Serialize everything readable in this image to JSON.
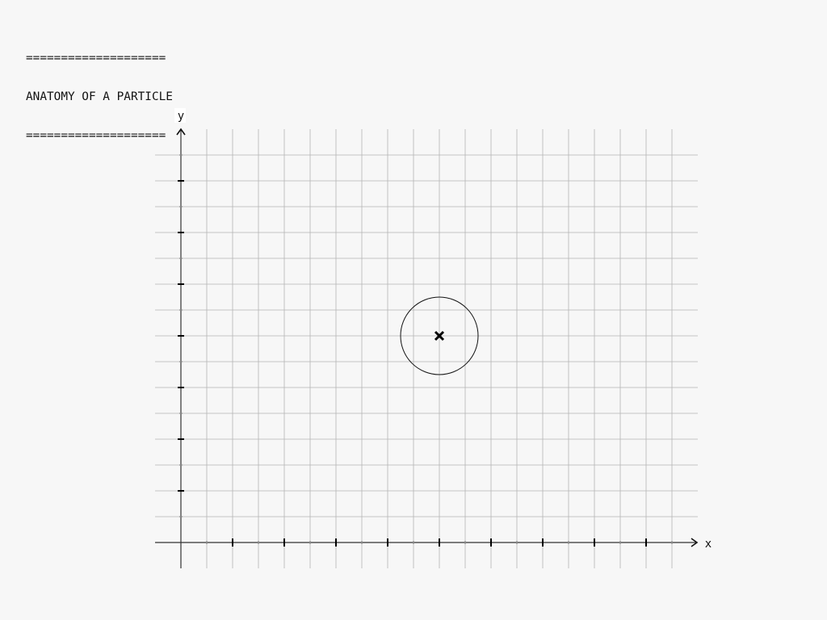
{
  "title": {
    "rule_top": "====================",
    "text": "ANATOMY OF A PARTICLE",
    "rule_bottom": "===================="
  },
  "axes": {
    "x_label": "x",
    "y_label": "y",
    "grid": true
  },
  "particle": {
    "marker": "x-mark",
    "outline": "circle"
  },
  "colors": {
    "background": "#f7f7f7",
    "grid": "#b3b3b3",
    "axis": "#333333",
    "ink": "#000000"
  }
}
